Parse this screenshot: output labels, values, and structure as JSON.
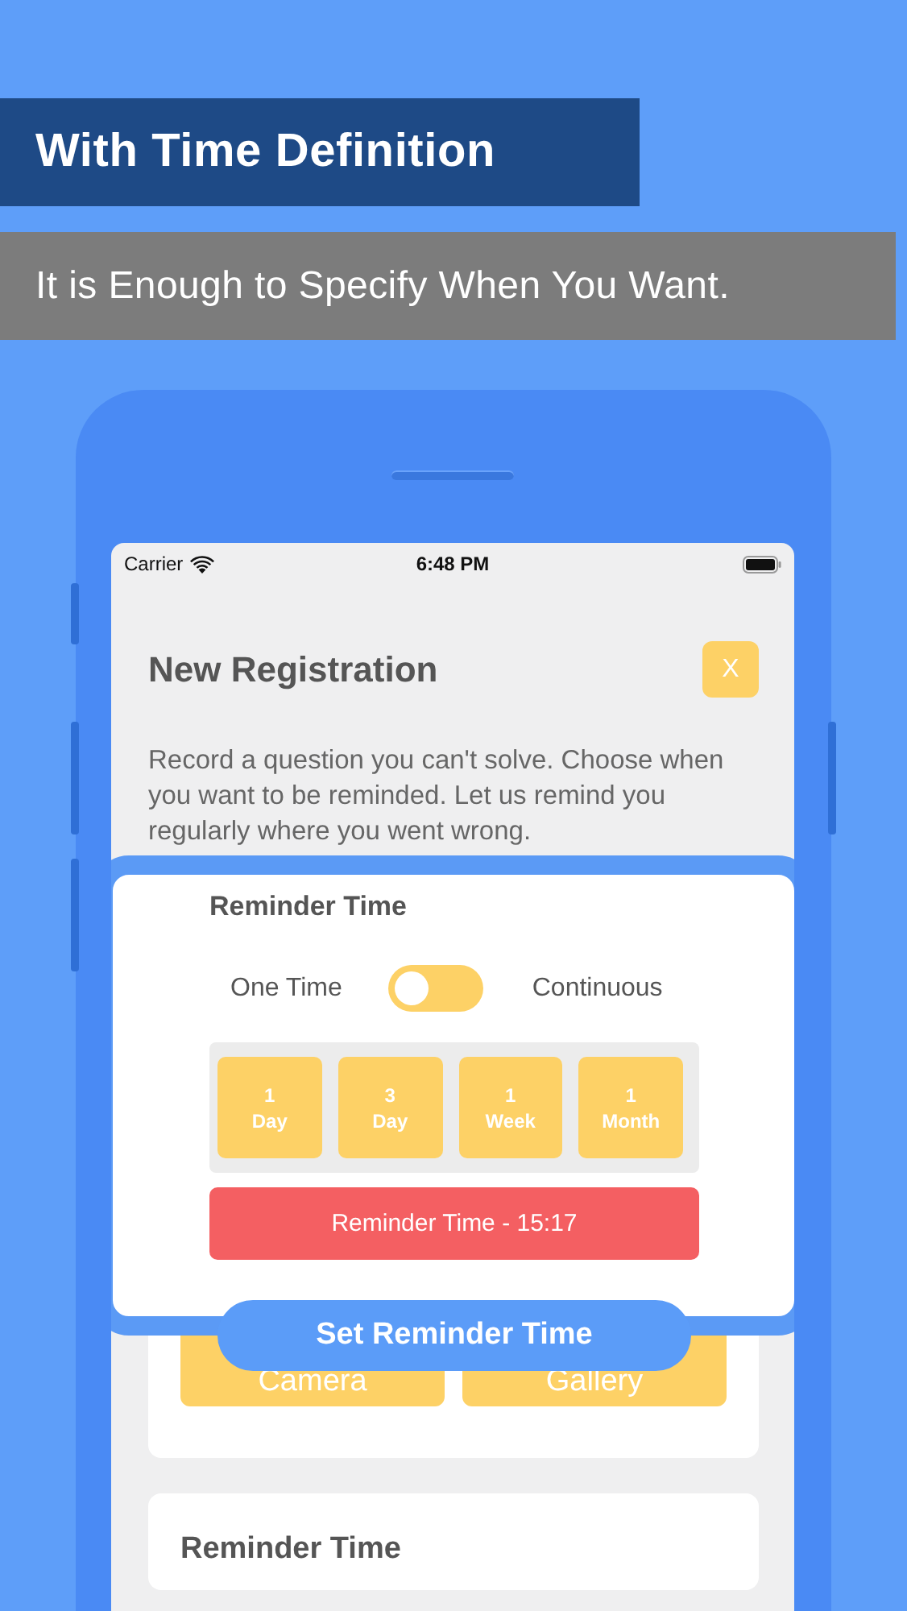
{
  "banner": {
    "title": "With Time Definition",
    "subtitle": "It is Enough to Specify When You Want."
  },
  "status_bar": {
    "carrier": "Carrier",
    "time": "6:48 PM"
  },
  "screen": {
    "title": "New Registration",
    "close_label": "X",
    "description": "Record a question you can't solve. Choose when you want to be reminded. Let us remind you regularly where you went wrong.",
    "media_buttons": [
      "Camera",
      "Gallery"
    ],
    "section_title": "Reminder Time"
  },
  "popup": {
    "title": "Reminder Time",
    "toggle": {
      "left_label": "One Time",
      "right_label": "Continuous",
      "on": false
    },
    "periods": [
      {
        "number": "1",
        "unit": "Day"
      },
      {
        "number": "3",
        "unit": "Day"
      },
      {
        "number": "1",
        "unit": "Week"
      },
      {
        "number": "1",
        "unit": "Month"
      }
    ],
    "reminder_button": "Reminder Time - 15:17",
    "set_button": "Set Reminder Time"
  }
}
